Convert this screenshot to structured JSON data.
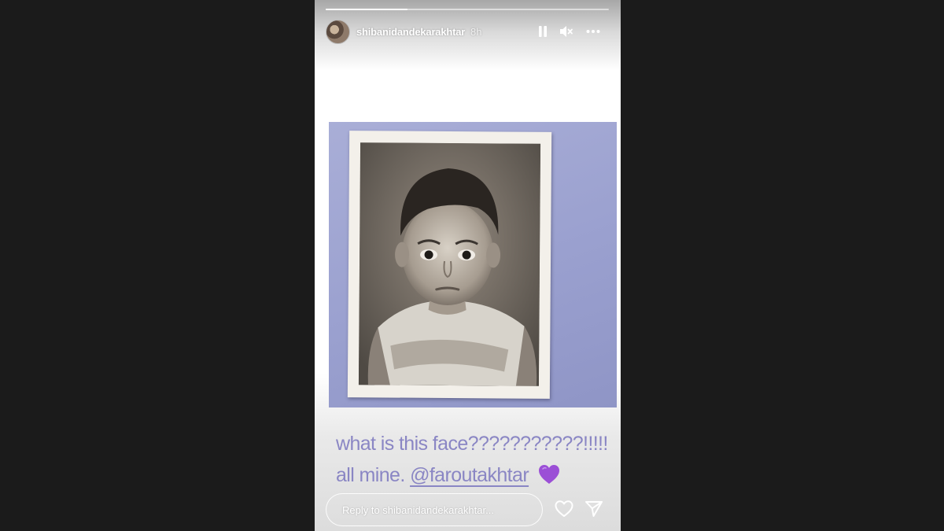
{
  "story": {
    "progress_fraction": 0.29,
    "username": "shibanidandekarakhtar",
    "time_ago": "8h",
    "icons": {
      "avatar": "profile-avatar",
      "pause": "pause-icon",
      "mute": "speaker-muted-icon",
      "more": "more-dots-icon",
      "like": "heart-outline-icon",
      "share": "paper-plane-icon"
    }
  },
  "caption": {
    "line1": "what is this face???????????!!!!!",
    "line2_prefix": "all mine.",
    "mention": "@faroutakhtar",
    "emoji": "purple-heart"
  },
  "reply": {
    "placeholder": "Reply to shibanidandekarakhtar..."
  },
  "colors": {
    "caption_text": "#8a86c4",
    "photo_background": "#9aa0cf",
    "emoji_heart": "#9b4fd6",
    "page_background": "#1b1b1b"
  }
}
